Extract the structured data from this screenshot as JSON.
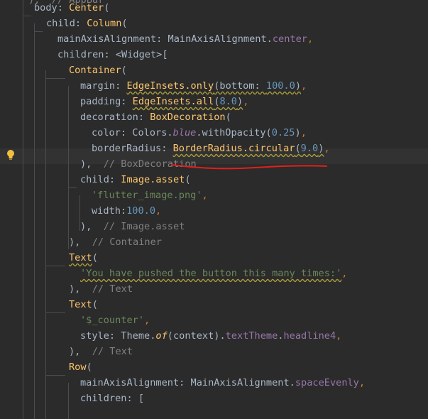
{
  "editor": {
    "lines": [
      {
        "id": "l0",
        "tokens": [
          {
            "t": "),  // AppBar",
            "c": "tk-comment"
          }
        ]
      },
      {
        "id": "l1",
        "tokens": [
          {
            "t": "body",
            "c": "tk-prop"
          },
          {
            "t": ": ",
            "c": "tk-plain"
          },
          {
            "t": "Center",
            "c": "tk-ctor"
          },
          {
            "t": "(",
            "c": "tk-plain"
          }
        ]
      },
      {
        "id": "l2",
        "tokens": [
          {
            "t": "child",
            "c": "tk-prop"
          },
          {
            "t": ": ",
            "c": "tk-plain"
          },
          {
            "t": "Column",
            "c": "tk-ctor"
          },
          {
            "t": "(",
            "c": "tk-plain"
          }
        ]
      },
      {
        "id": "l3",
        "tokens": [
          {
            "t": "mainAxisAlignment",
            "c": "tk-prop"
          },
          {
            "t": ": ",
            "c": "tk-plain"
          },
          {
            "t": "MainAxisAlignment",
            "c": "tk-plain"
          },
          {
            "t": ".",
            "c": "tk-plain"
          },
          {
            "t": "center",
            "c": "tk-field"
          },
          {
            "t": ",",
            "c": "tk-kw"
          }
        ]
      },
      {
        "id": "l4",
        "tokens": [
          {
            "t": "children",
            "c": "tk-prop"
          },
          {
            "t": ": <",
            "c": "tk-plain"
          },
          {
            "t": "Widget",
            "c": "tk-plain"
          },
          {
            "t": ">[",
            "c": "tk-plain"
          }
        ]
      },
      {
        "id": "l5",
        "tokens": [
          {
            "t": "Container",
            "c": "tk-ctor"
          },
          {
            "t": "(",
            "c": "tk-plain"
          }
        ]
      },
      {
        "id": "l6",
        "tokens": [
          {
            "t": "margin",
            "c": "tk-prop"
          },
          {
            "t": ": ",
            "c": "tk-plain"
          },
          {
            "t": "EdgeInsets.only",
            "c": "tk-ctor wavy"
          },
          {
            "t": "(bottom: ",
            "c": "tk-plain wavy"
          },
          {
            "t": "100.0",
            "c": "tk-num wavy"
          },
          {
            "t": ")",
            "c": "tk-plain wavy"
          },
          {
            "t": ",",
            "c": "tk-kw"
          }
        ]
      },
      {
        "id": "l7",
        "tokens": [
          {
            "t": "padding",
            "c": "tk-prop"
          },
          {
            "t": ": ",
            "c": "tk-plain"
          },
          {
            "t": "EdgeInsets.all",
            "c": "tk-ctor wavy"
          },
          {
            "t": "(",
            "c": "tk-plain wavy"
          },
          {
            "t": "8.0",
            "c": "tk-num wavy"
          },
          {
            "t": ")",
            "c": "tk-plain wavy"
          },
          {
            "t": ",",
            "c": "tk-kw"
          }
        ]
      },
      {
        "id": "l8",
        "tokens": [
          {
            "t": "decoration",
            "c": "tk-prop"
          },
          {
            "t": ": ",
            "c": "tk-plain"
          },
          {
            "t": "BoxDecoration",
            "c": "tk-ctor"
          },
          {
            "t": "(",
            "c": "tk-plain"
          }
        ]
      },
      {
        "id": "l9",
        "tokens": [
          {
            "t": "color",
            "c": "tk-prop"
          },
          {
            "t": ": ",
            "c": "tk-plain"
          },
          {
            "t": "Colors",
            "c": "tk-plain"
          },
          {
            "t": ".",
            "c": "tk-plain"
          },
          {
            "t": "blue",
            "c": "tk-italic"
          },
          {
            "t": ".withOpacity(",
            "c": "tk-plain"
          },
          {
            "t": "0.25",
            "c": "tk-num"
          },
          {
            "t": ")",
            "c": "tk-plain"
          },
          {
            "t": ",",
            "c": "tk-kw"
          }
        ]
      },
      {
        "id": "l10",
        "tokens": [
          {
            "t": "borderRadius",
            "c": "tk-prop"
          },
          {
            "t": ": ",
            "c": "tk-plain"
          },
          {
            "t": "BorderRadius.circular",
            "c": "tk-ctor wavy"
          },
          {
            "t": "(",
            "c": "tk-plain wavy"
          },
          {
            "t": "9.0",
            "c": "tk-num wavy"
          },
          {
            "t": ")",
            "c": "tk-plain wavy"
          },
          {
            "t": ",",
            "c": "tk-kw"
          }
        ]
      },
      {
        "id": "l11",
        "tokens": [
          {
            "t": "),",
            "c": "tk-plain"
          },
          {
            "t": "  // BoxDecoration",
            "c": "tk-comment"
          }
        ]
      },
      {
        "id": "l12",
        "tokens": [
          {
            "t": "child",
            "c": "tk-prop"
          },
          {
            "t": ": ",
            "c": "tk-plain"
          },
          {
            "t": "Image.asset",
            "c": "tk-ctor"
          },
          {
            "t": "(",
            "c": "tk-plain"
          }
        ]
      },
      {
        "id": "l13",
        "tokens": [
          {
            "t": "'flutter_image.png'",
            "c": "tk-str"
          },
          {
            "t": ",",
            "c": "tk-kw"
          }
        ]
      },
      {
        "id": "l14",
        "tokens": [
          {
            "t": "width",
            "c": "tk-prop"
          },
          {
            "t": ":",
            "c": "tk-plain"
          },
          {
            "t": "100.0",
            "c": "tk-num"
          },
          {
            "t": ",",
            "c": "tk-kw"
          }
        ]
      },
      {
        "id": "l15",
        "tokens": [
          {
            "t": "),",
            "c": "tk-plain"
          },
          {
            "t": "  // Image.asset",
            "c": "tk-comment"
          }
        ]
      },
      {
        "id": "l16",
        "tokens": [
          {
            "t": "),",
            "c": "tk-plain"
          },
          {
            "t": "  // Container",
            "c": "tk-comment"
          }
        ]
      },
      {
        "id": "l17",
        "tokens": [
          {
            "t": "Text",
            "c": "tk-ctor wavy"
          },
          {
            "t": "(",
            "c": "tk-plain"
          }
        ]
      },
      {
        "id": "l18",
        "tokens": [
          {
            "t": "'You have pushed the button this many times:'",
            "c": "tk-str wavy"
          },
          {
            "t": ",",
            "c": "tk-kw"
          }
        ]
      },
      {
        "id": "l19",
        "tokens": [
          {
            "t": "),",
            "c": "tk-plain"
          },
          {
            "t": "  // Text",
            "c": "tk-comment"
          }
        ]
      },
      {
        "id": "l20",
        "tokens": [
          {
            "t": "Text",
            "c": "tk-ctor"
          },
          {
            "t": "(",
            "c": "tk-plain"
          }
        ]
      },
      {
        "id": "l21",
        "tokens": [
          {
            "t": "'$_counter'",
            "c": "tk-str"
          },
          {
            "t": ",",
            "c": "tk-kw"
          }
        ]
      },
      {
        "id": "l22",
        "tokens": [
          {
            "t": "style",
            "c": "tk-prop"
          },
          {
            "t": ": ",
            "c": "tk-plain"
          },
          {
            "t": "Theme",
            "c": "tk-plain"
          },
          {
            "t": ".",
            "c": "tk-plain"
          },
          {
            "t": "of",
            "c": "tk-method"
          },
          {
            "t": "(context).",
            "c": "tk-plain"
          },
          {
            "t": "textTheme",
            "c": "tk-field"
          },
          {
            "t": ".",
            "c": "tk-plain"
          },
          {
            "t": "headline4",
            "c": "tk-field"
          },
          {
            "t": ",",
            "c": "tk-kw"
          }
        ]
      },
      {
        "id": "l23",
        "tokens": [
          {
            "t": "),",
            "c": "tk-plain"
          },
          {
            "t": "  // Text",
            "c": "tk-comment"
          }
        ]
      },
      {
        "id": "l24",
        "tokens": [
          {
            "t": "Row",
            "c": "tk-ctor"
          },
          {
            "t": "(",
            "c": "tk-plain"
          }
        ]
      },
      {
        "id": "l25",
        "tokens": [
          {
            "t": "mainAxisAlignment",
            "c": "tk-prop"
          },
          {
            "t": ": ",
            "c": "tk-plain"
          },
          {
            "t": "MainAxisAlignment",
            "c": "tk-plain"
          },
          {
            "t": ".",
            "c": "tk-plain"
          },
          {
            "t": "spaceEvenly",
            "c": "tk-field"
          },
          {
            "t": ",",
            "c": "tk-kw"
          }
        ]
      },
      {
        "id": "l26",
        "tokens": [
          {
            "t": "children",
            "c": "tk-prop"
          },
          {
            "t": ": [",
            "c": "tk-plain"
          }
        ]
      }
    ]
  },
  "colors": {
    "background": "#2b2b2b",
    "annotation_stroke": "#e0201c",
    "bulb": "#f0c040"
  },
  "icons": {
    "intention": "lightbulb-icon"
  }
}
